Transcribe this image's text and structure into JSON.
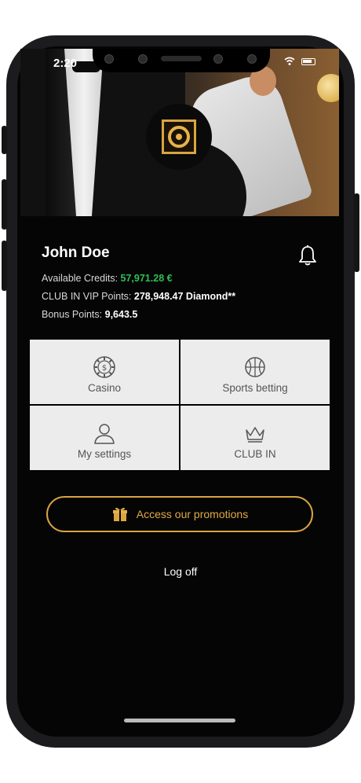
{
  "status_bar": {
    "time": "2:20"
  },
  "profile": {
    "name": "John Doe",
    "credits_label": "Available Credits:",
    "credits_value": "57,971.28 €",
    "vip_label": "CLUB IN VIP Points:",
    "vip_value": "278,948.47 Diamond**",
    "bonus_label": "Bonus Points:",
    "bonus_value": "9,643.5"
  },
  "tiles": [
    {
      "label": "Casino",
      "icon": "casino-chip-icon"
    },
    {
      "label": "Sports betting",
      "icon": "basketball-icon"
    },
    {
      "label": "My settings",
      "icon": "user-icon"
    },
    {
      "label": "CLUB IN",
      "icon": "crown-icon"
    }
  ],
  "promo": {
    "label": "Access our promotions",
    "icon": "gift-icon"
  },
  "logoff": {
    "label": "Log off"
  },
  "colors": {
    "accent": "#d9a441",
    "credits": "#2fbf55",
    "tile_bg": "#ececec",
    "background": "#050505"
  }
}
